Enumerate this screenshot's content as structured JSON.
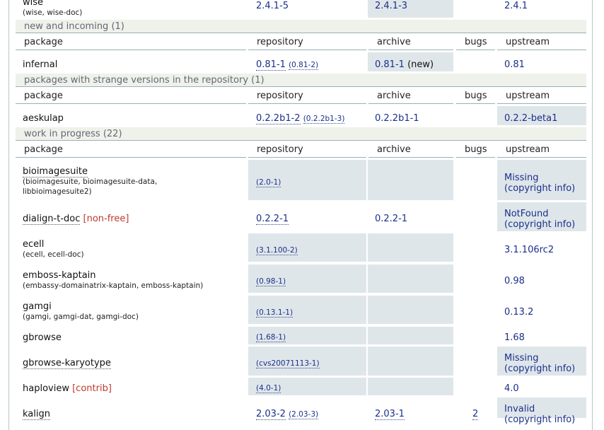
{
  "top_row": {
    "name": "wise",
    "sub": "(wise, wise-doc)",
    "repository": "2.4.1-5",
    "archive": "2.4.1-3",
    "upstream": "2.4.1"
  },
  "sections": {
    "new": "new and incoming (1)",
    "strange": "packages with strange versions in the repository (1)",
    "wip": "work in progress (22)"
  },
  "headers": {
    "package": "package",
    "repository": "repository",
    "archive": "archive",
    "bugs": "bugs",
    "upstream": "upstream"
  },
  "new_row": {
    "name": "infernal",
    "repository": "0.81-1",
    "repository_alt": "(0.81-2)",
    "archive": "0.81-1",
    "archive_note": "(new)",
    "upstream": "0.81"
  },
  "strange_row": {
    "name": "aeskulap",
    "repository": "0.2.2b1-2",
    "repository_alt": "(0.2.2b1-3)",
    "archive": "0.2.2b1-1",
    "upstream": "0.2.2-beta1"
  },
  "wip": [
    {
      "name": "bioimagesuite",
      "sub1": "(bioimagesuite, bioimagesuite-data,",
      "sub2": "libbioimagesuite2)",
      "repository": "(2.0-1)",
      "upstream1": "Missing",
      "upstream2": "(copyright info)"
    },
    {
      "name": "dialign-t-doc",
      "flag": "[non-free]",
      "repository": "0.2.2-1",
      "archive": "0.2.2-1",
      "upstream1": "NotFound",
      "upstream2": "(copyright info)"
    },
    {
      "name": "ecell",
      "sub1": "(ecell, ecell-doc)",
      "repository": "(3.1.100-2)",
      "upstream1": "3.1.106rc2"
    },
    {
      "name": "emboss-kaptain",
      "sub1": "(embassy-domainatrix-kaptain, emboss-kaptain)",
      "repository": "(0.98-1)",
      "upstream1": "0.98"
    },
    {
      "name": "gamgi",
      "sub1": "(gamgi, gamgi-dat, gamgi-doc)",
      "repository": "(0.13.1-1)",
      "upstream1": "0.13.2"
    },
    {
      "name": "gbrowse",
      "repository": "(1.68-1)",
      "upstream1": "1.68"
    },
    {
      "name": "gbrowse-karyotype",
      "repository": "(cvs20071113-1)",
      "upstream1": "Missing",
      "upstream2": "(copyright info)"
    },
    {
      "name": "haploview",
      "flag": "[contrib]",
      "repository": "(4.0-1)",
      "upstream1": "4.0"
    },
    {
      "name": "kalign",
      "repository": "2.03-2",
      "repository_alt": "(2.03-3)",
      "archive": "2.03-1",
      "bugs": "2",
      "upstream1": "Invalid",
      "upstream2": "(copyright info)"
    }
  ]
}
